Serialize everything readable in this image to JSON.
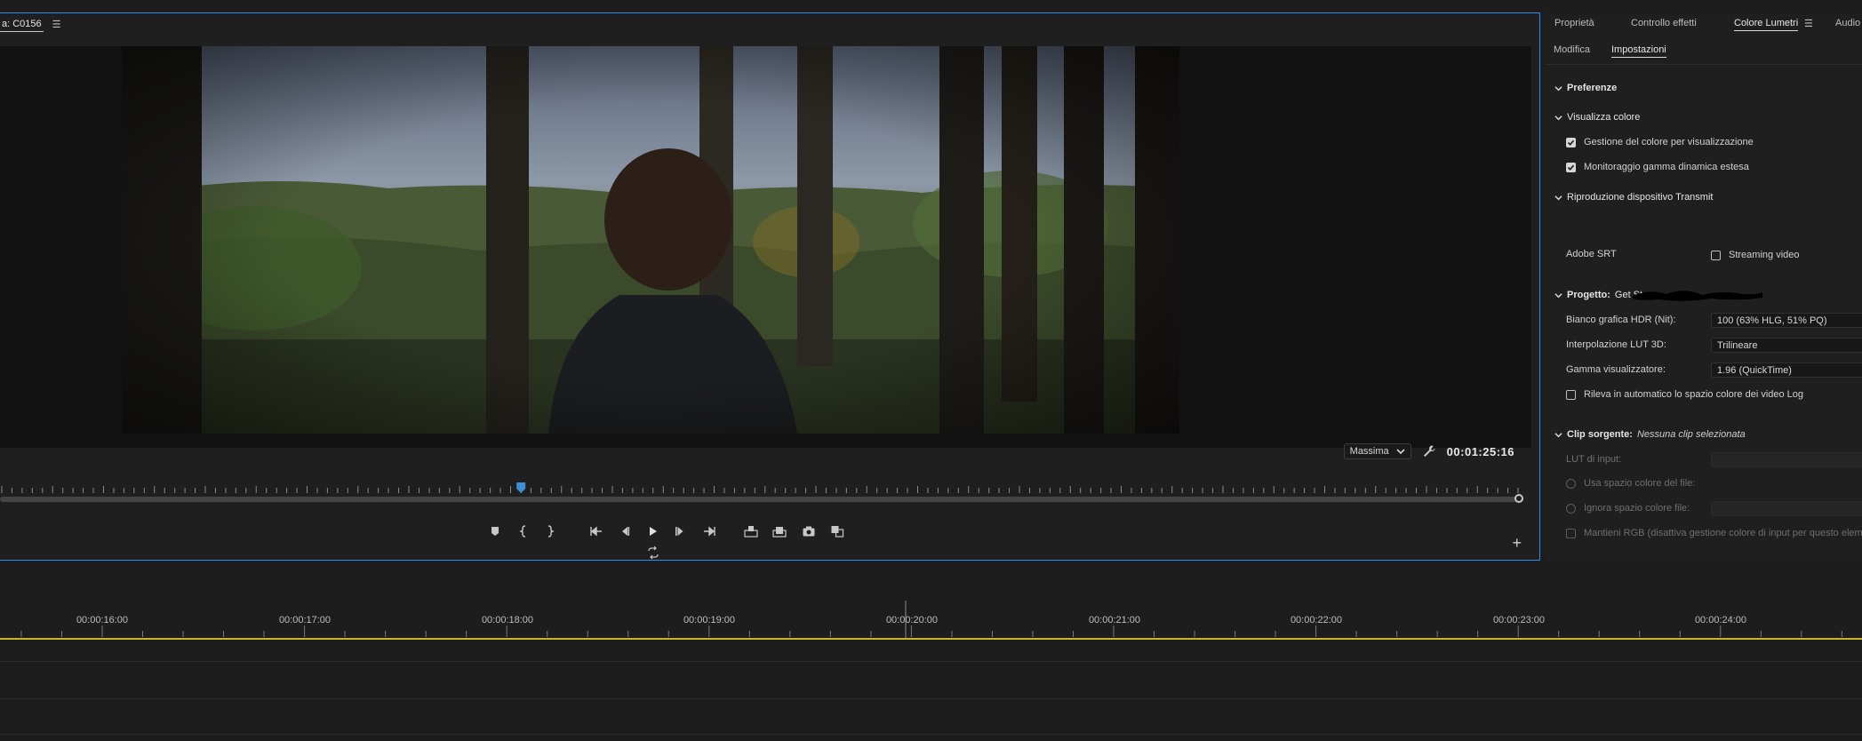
{
  "colors": {
    "accent_blue": "#2d8ceb",
    "playhead_blue": "#3d8fd8",
    "timeline_yellow": "#c8b62a"
  },
  "monitor": {
    "tab_label": "a: C0156",
    "tab_menu_icon": "hamburger-menu-icon",
    "quality": "Massima",
    "timecode": "00:01:25:16",
    "playhead_position": 0.342
  },
  "transport": {
    "buttons": [
      "add-marker",
      "mark-in",
      "mark-out",
      "go-to-in",
      "step-back",
      "play",
      "step-forward",
      "go-to-out",
      "insert",
      "overwrite",
      "export-frame",
      "comparison-view",
      "loop-playback"
    ]
  },
  "right_panel": {
    "tabs": [
      "Proprietà",
      "Controllo effetti",
      "Colore Lumetri",
      "Audio"
    ],
    "active_tab": "Colore Lumetri",
    "subtabs": [
      "Modifica",
      "Impostazioni"
    ],
    "active_subtab": "Impostazioni",
    "sections": {
      "preferenze": "Preferenze",
      "visualizza_colore": "Visualizza colore",
      "gestione_colore": "Gestione del colore per visualizzazione",
      "monitoraggio": "Monitoraggio gamma dinamica estesa",
      "riproduzione": "Riproduzione dispositivo Transmit",
      "adobe_srt": "Adobe SRT",
      "streaming_video": "Streaming video",
      "progetto": "Progetto:",
      "progetto_name": "Get Star",
      "bianco_label": "Bianco grafica HDR (Nit):",
      "bianco_value": "100 (63% HLG, 51% PQ)",
      "lut_label": "Interpolazione LUT 3D:",
      "lut_value": "Trilineare",
      "gamma_label": "Gamma visualizzatore:",
      "gamma_value": "1.96 (QuickTime)",
      "rileva": "Rileva in automatico lo spazio colore dei video Log",
      "clip_sorgente": "Clip sorgente:",
      "nessuna_clip": "Nessuna clip selezionata",
      "lut_input": "LUT di input:",
      "usa_spazio": "Usa spazio colore del file:",
      "ignora_spazio": "Ignora spazio colore file:",
      "mantieni_rgb": "Mantieni RGB (disattiva gestione colore di input per questo elem"
    }
  },
  "timeline": {
    "times": [
      "00:00:16:00",
      "00:00:17:00",
      "00:00:18:00",
      "00:00:19:00",
      "00:00:20:00",
      "00:00:21:00",
      "00:00:22:00",
      "00:00:23:00",
      "00:00:24:00"
    ]
  }
}
